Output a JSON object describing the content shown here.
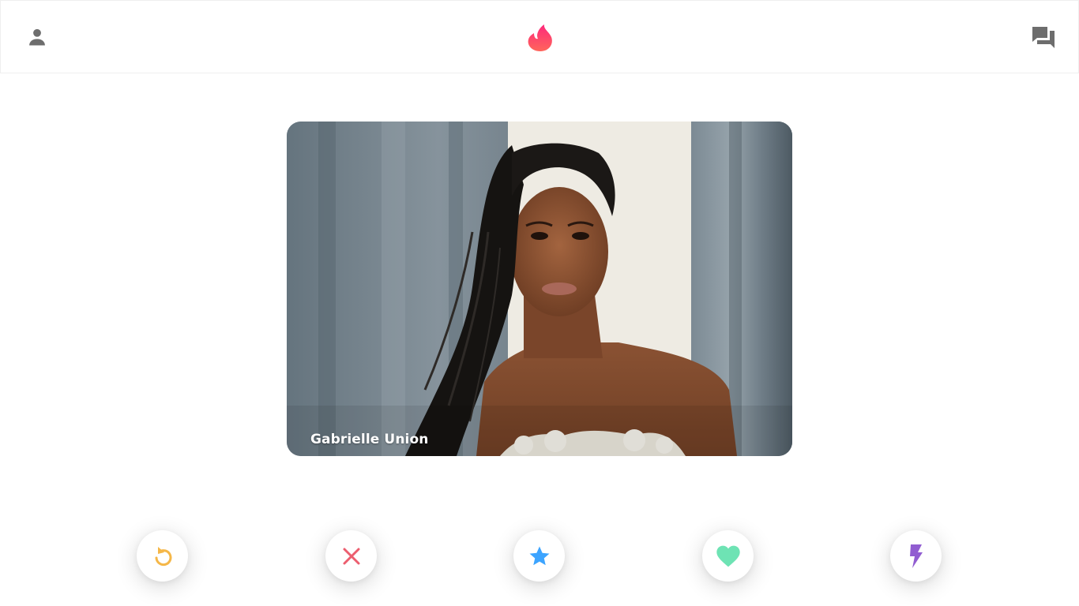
{
  "header": {
    "profile_icon": "person-icon",
    "logo_icon": "flame-logo",
    "messages_icon": "chat-bubbles-icon"
  },
  "card": {
    "name": "Gabrielle Union"
  },
  "actions": [
    {
      "id": "rewind",
      "icon": "rewind-icon",
      "color": "#f5b748"
    },
    {
      "id": "nope",
      "icon": "close-icon",
      "color": "#ec5e6f"
    },
    {
      "id": "super_like",
      "icon": "star-icon",
      "color": "#3ca4ff"
    },
    {
      "id": "like",
      "icon": "heart-icon",
      "color": "#6ee3b4"
    },
    {
      "id": "boost",
      "icon": "lightning-icon",
      "color": "#915dd1"
    }
  ],
  "colors": {
    "brand_gradient_start": "#fd297b",
    "brand_gradient_end": "#ff655b",
    "icon_gray": "#6d6d6d"
  }
}
